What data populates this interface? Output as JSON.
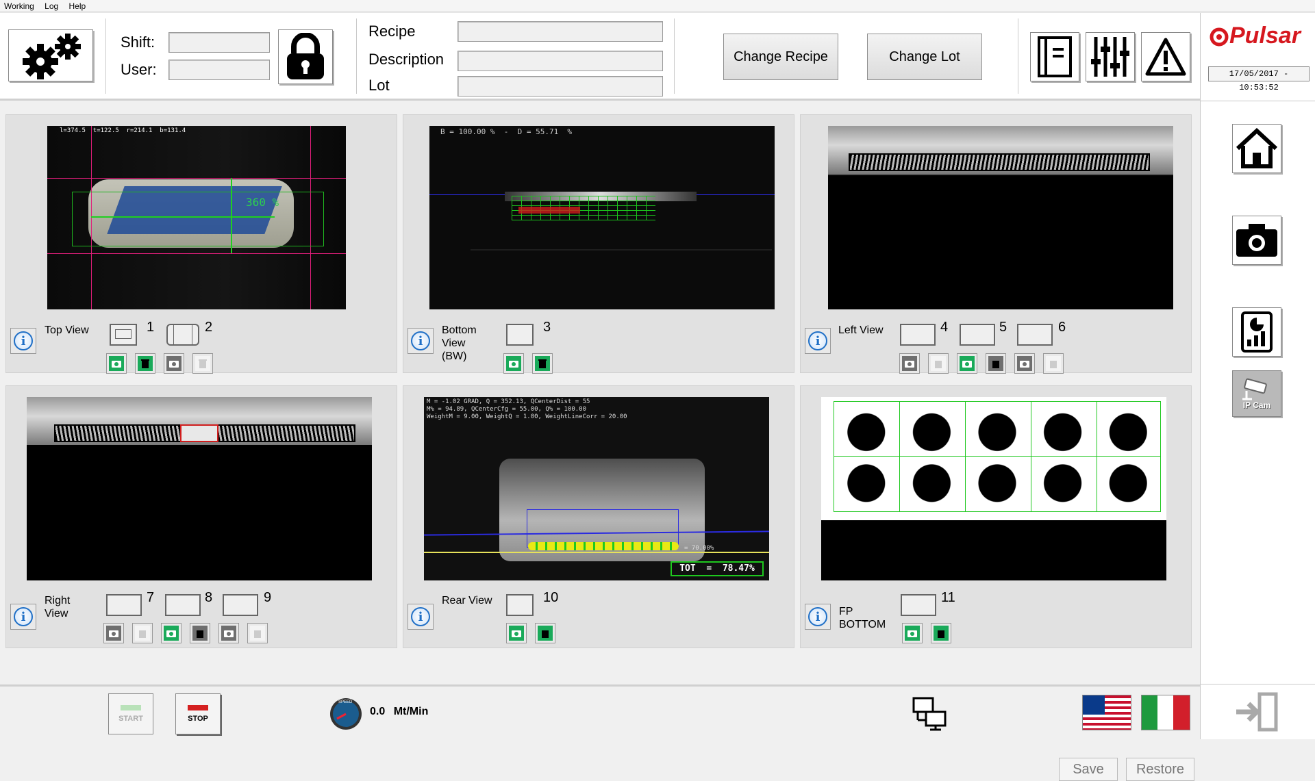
{
  "menu": [
    "Working",
    "Log",
    "Help"
  ],
  "header": {
    "shift_label": "Shift:",
    "user_label": "User:",
    "recipe_label": "Recipe",
    "description_label": "Description",
    "lot_label": "Lot",
    "shift_value": "",
    "user_value": "",
    "recipe_value": "",
    "description_value": "",
    "lot_value": "",
    "change_recipe": "Change Recipe",
    "change_lot": "Change Lot"
  },
  "brand": {
    "name": "Pulsar",
    "accent_color": "#d6181f"
  },
  "datetime": "17/05/2017 - 10:53:52",
  "side": {
    "ipcam_label": "IP Cam"
  },
  "views": {
    "top": {
      "label": "Top View",
      "overlay": "l=374.5  t=122.5  r=214.1  b=131.4",
      "pct": "360 %",
      "tools": [
        "1",
        "2"
      ]
    },
    "bottom": {
      "label_line1": "Bottom",
      "label_line2": "View",
      "label_line3": "(BW)",
      "overlay": "B = 100.00 %  -  D = 55.71  %",
      "tools": [
        "3"
      ]
    },
    "left": {
      "label": "Left View",
      "tools": [
        "4",
        "5",
        "6"
      ]
    },
    "right": {
      "label_line1": "Right",
      "label_line2": "View",
      "tools": [
        "7",
        "8",
        "9"
      ]
    },
    "rear": {
      "label": "Rear View",
      "overlay1": "M = -1.02 GRAD, Q = 352.13, QCenterDist = 55",
      "overlay2": "M% = 94.89, QCenterCfg = 55.00, Q% = 100.00",
      "overlay3": "WeightM = 9.00, WeightQ = 1.00, WeightLineCorr = 20.00",
      "line_pct": "= 70.00%",
      "tot": "TOT  =  78.47%",
      "tools": [
        "10"
      ]
    },
    "fp": {
      "label_line1": "FP",
      "label_line2": "BOTTOM",
      "tools": [
        "11"
      ]
    }
  },
  "actions": {
    "save": "Save",
    "restore": "Restore"
  },
  "footer": {
    "start": "START",
    "stop": "STOP",
    "speed_value": "0.0",
    "speed_unit": "Mt/Min",
    "gauge_label": "SPEED"
  }
}
